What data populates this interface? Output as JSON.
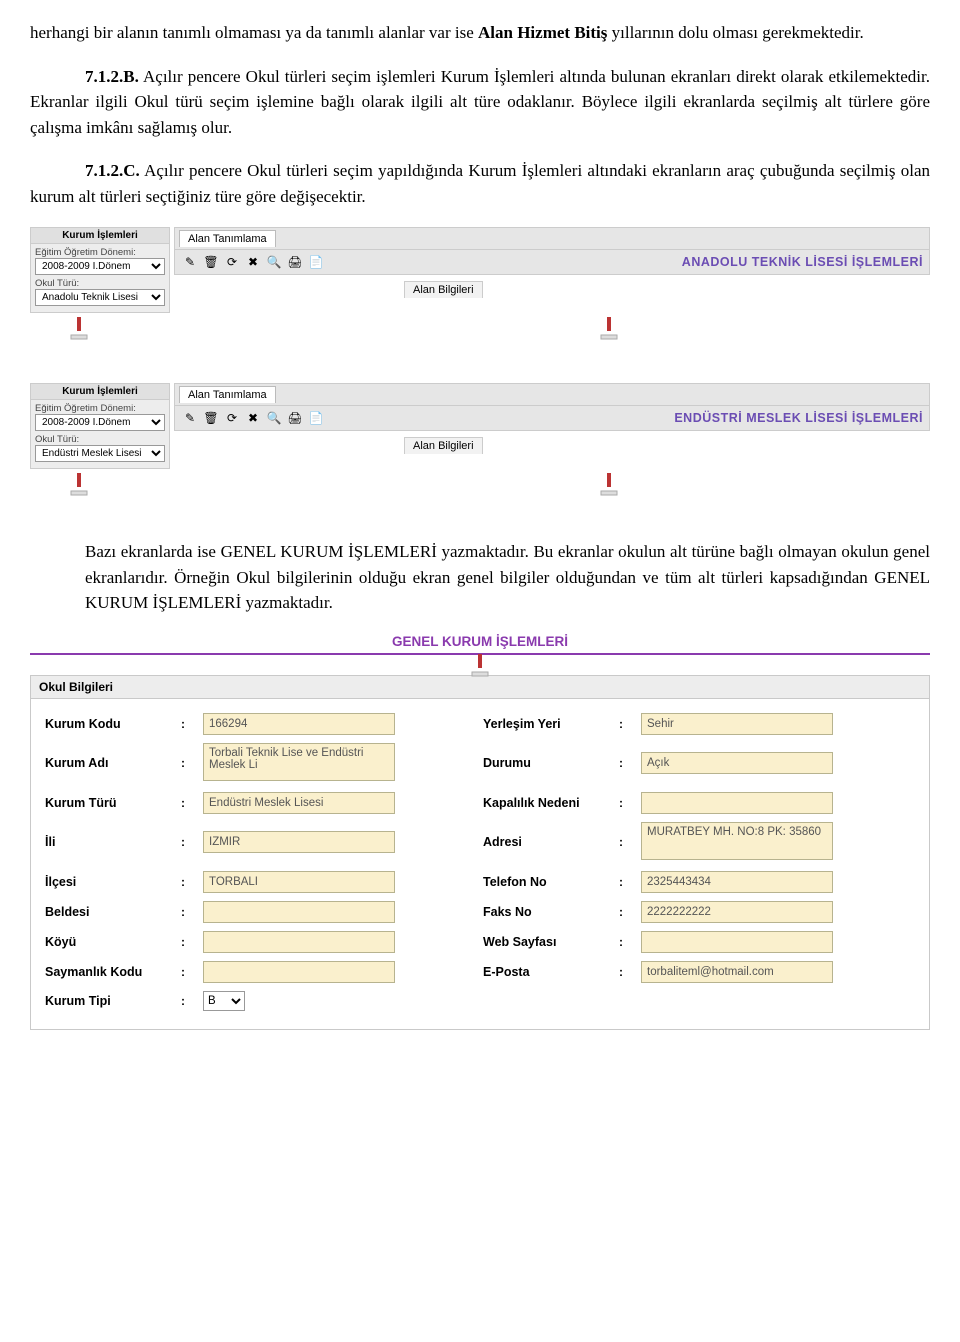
{
  "para1": {
    "prefix": "herhangi bir alanın tanımlı olmaması ya da tanımlı alanlar var ise ",
    "bold": "Alan Hizmet Bitiş",
    "suffix": " yıllarının dolu olması gerekmektedir."
  },
  "para2": {
    "label": "7.1.2.B.",
    "text": " Açılır pencere Okul türleri seçim işlemleri Kurum İşlemleri altında bulunan ekranları direkt olarak etkilemektedir. Ekranlar ilgili Okul türü seçim işlemine bağlı olarak ilgili alt türe odaklanır. Böylece ilgili ekranlarda seçilmiş alt türlere göre çalışma imkânı sağlamış olur."
  },
  "para3": {
    "label": "7.1.2.C.",
    "text": " Açılır pencere Okul türleri seçim yapıldığında Kurum İşlemleri altındaki ekranların araç çubuğunda seçilmiş olan kurum alt türleri seçtiğiniz türe göre değişecektir."
  },
  "screenshot1": {
    "sidebarTitle": "Kurum İşlemleri",
    "donemLabel": "Eğitim Öğretim Dönemi:",
    "donemValue": "2008-2009 I.Dönem",
    "okulLabel": "Okul Türü:",
    "okulValue": "Anadolu Teknik Lisesi",
    "tab": "Alan Tanımlama",
    "toolbarTitle": "ANADOLU TEKNİK LİSESİ İŞLEMLERİ",
    "alanBilgileri": "Alan Bilgileri"
  },
  "screenshot2": {
    "sidebarTitle": "Kurum İşlemleri",
    "donemLabel": "Eğitim Öğretim Dönemi:",
    "donemValue": "2008-2009 I.Dönem",
    "okulLabel": "Okul Türü:",
    "okulValue": "Endüstri Meslek Lisesi",
    "tab": "Alan Tanımlama",
    "toolbarTitle": "ENDÜSTRİ MESLEK LİSESİ İŞLEMLERİ",
    "alanBilgileri": "Alan Bilgileri"
  },
  "para4": "Bazı ekranlarda ise GENEL KURUM İŞLEMLERİ yazmaktadır. Bu ekranlar okulun alt türüne bağlı olmayan okulun genel ekranlarıdır. Örneğin Okul bilgilerinin olduğu ekran genel bilgiler olduğundan ve tüm alt türleri kapsadığından GENEL KURUM İŞLEMLERİ yazmaktadır.",
  "okul": {
    "header": "GENEL KURUM İŞLEMLERİ",
    "boxTitle": "Okul Bilgileri",
    "labels": {
      "kurumKodu": "Kurum Kodu",
      "kurumAdi": "Kurum Adı",
      "kurumTuru": "Kurum Türü",
      "ili": "İli",
      "ilcesi": "İlçesi",
      "beldesi": "Beldesi",
      "koyu": "Köyü",
      "saymanlik": "Saymanlık Kodu",
      "kurumTipi": "Kurum Tipi",
      "yerlesim": "Yerleşim Yeri",
      "durumu": "Durumu",
      "kapalilik": "Kapalılık Nedeni",
      "adresi": "Adresi",
      "telefon": "Telefon No",
      "faks": "Faks No",
      "web": "Web Sayfası",
      "eposta": "E-Posta"
    },
    "values": {
      "kurumKodu": "166294",
      "kurumAdi": "Torbali Teknik Lise ve Endüstri Meslek Li",
      "kurumTuru": "Endüstri Meslek Lisesi",
      "ili": "IZMIR",
      "ilcesi": "TORBALI",
      "beldesi": "",
      "koyu": "",
      "saymanlik": "",
      "kurumTipi": "B",
      "yerlesim": "Sehir",
      "durumu": "Açık",
      "kapalilik": "",
      "adresi": "MURATBEY MH. NO:8 PK: 35860",
      "telefon": "2325443434",
      "faks": "2222222222",
      "web": "",
      "eposta": "torbaliteml@hotmail.com"
    }
  }
}
